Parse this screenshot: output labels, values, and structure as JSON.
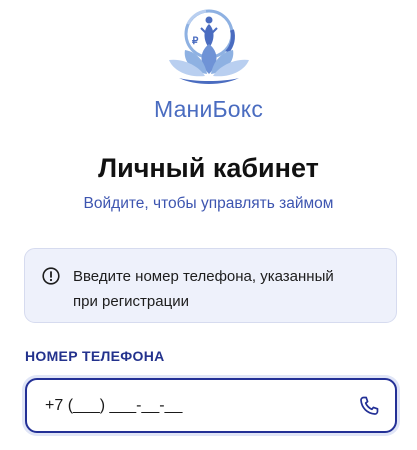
{
  "brand": {
    "name": "МаниБокс",
    "color": "#4a6cc0"
  },
  "page": {
    "title": "Личный кабинет",
    "subtitle": "Войдите, чтобы управлять займом"
  },
  "info": {
    "icon": "info-circle-icon",
    "line1": "Введите номер телефона, указанный",
    "line2": "при регистрации"
  },
  "phone": {
    "label": "НОМЕР ТЕЛЕФОНА",
    "placeholder": "+7 (___) ___-__-__",
    "icon": "phone-icon",
    "border_color": "#233096"
  }
}
